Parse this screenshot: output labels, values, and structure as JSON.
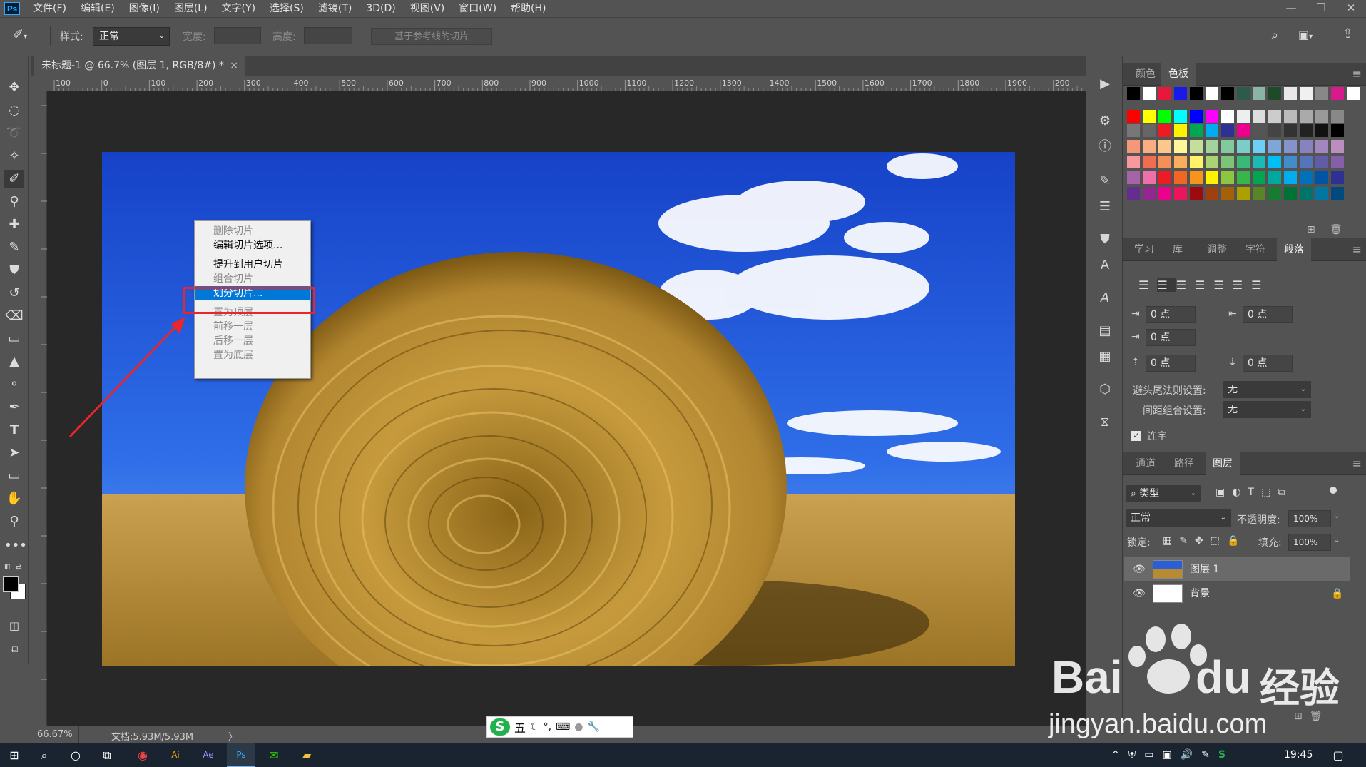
{
  "menubar": {
    "logo": "Ps",
    "items": [
      "文件(F)",
      "编辑(E)",
      "图像(I)",
      "图层(L)",
      "文字(Y)",
      "选择(S)",
      "滤镜(T)",
      "3D(D)",
      "视图(V)",
      "窗口(W)",
      "帮助(H)"
    ]
  },
  "window_controls": {
    "minimize": "—",
    "restore": "❐",
    "close": "✕"
  },
  "options": {
    "style_label": "样式:",
    "style_value": "正常",
    "width_label": "宽度:",
    "height_label": "高度:",
    "guides_button": "基于参考线的切片"
  },
  "document": {
    "tab_title": "未标题-1 @ 66.7% (图层 1, RGB/8#) *",
    "close": "×",
    "zoom": "66.67%",
    "doc_size": "文档:5.93M/5.93M",
    "arrow": "〉"
  },
  "ruler_h": [
    "100",
    "0",
    "100",
    "200",
    "300",
    "400",
    "500",
    "600",
    "700",
    "800",
    "900",
    "1000",
    "1100",
    "1200",
    "1300",
    "1400",
    "1500",
    "1600",
    "1700",
    "1800",
    "1900",
    "200"
  ],
  "context_menu": {
    "items": [
      {
        "label": "删除切片",
        "state": "disabled"
      },
      {
        "label": "编辑切片选项...",
        "state": "enabled"
      },
      {
        "label": "提升到用户切片",
        "state": "enabled"
      },
      {
        "label": "组合切片",
        "state": "disabled"
      },
      {
        "label": "划分切片...",
        "state": "highlighted"
      },
      {
        "label": "置为顶层",
        "state": "disabled"
      },
      {
        "label": "前移一层",
        "state": "disabled"
      },
      {
        "label": "后移一层",
        "state": "disabled"
      },
      {
        "label": "置为底层",
        "state": "disabled"
      }
    ]
  },
  "swatches_panel": {
    "tabs": [
      "颜色",
      "色板"
    ],
    "active": "色板",
    "colors": [
      [
        "#000000",
        "#ffffff",
        "#e8183c",
        "#1a1ae8",
        "#000000",
        "#ffffff",
        "#000000",
        "#2d5a4a",
        "#8ab4a8",
        "#1f4a2a",
        "#e8e8e8",
        "#f0f0f0",
        "#888888",
        "#d81b8c",
        "#ffffff"
      ],
      [
        "#ff0000",
        "#ffff00",
        "#00ff00",
        "#00ffff",
        "#0000ff",
        "#ff00ff",
        "#ffffff",
        "#eeeeee",
        "#dddddd",
        "#cccccc",
        "#bbbbbb",
        "#aaaaaa",
        "#999999",
        "#888888"
      ],
      [
        "#777777",
        "#666666",
        "#ed1c24",
        "#fff200",
        "#00a651",
        "#00aeef",
        "#2e3192",
        "#ec008c",
        "#555555",
        "#444444",
        "#333333",
        "#222222",
        "#111111",
        "#000000"
      ],
      [
        "#f7977a",
        "#f9ad81",
        "#fdc68a",
        "#fff79a",
        "#c4df9b",
        "#a3d39c",
        "#82ca9d",
        "#7bcdc8",
        "#6ecff6",
        "#7ea7d8",
        "#8493ca",
        "#8882be",
        "#a187be",
        "#bc8dbf"
      ],
      [
        "#f6989d",
        "#f26c4f",
        "#f68e55",
        "#fbaf5c",
        "#fff467",
        "#acd372",
        "#7cc576",
        "#3bb878",
        "#1abbb4",
        "#00bff3",
        "#438ccb",
        "#5574b9",
        "#605ca8",
        "#855fa8"
      ],
      [
        "#a763a8",
        "#f06eaa",
        "#ed1c24",
        "#f26522",
        "#f7941d",
        "#fff200",
        "#8dc73f",
        "#39b54a",
        "#00a651",
        "#00a99d",
        "#00aeef",
        "#0072bc",
        "#0054a6",
        "#2e3192"
      ],
      [
        "#662d91",
        "#92278f",
        "#ec008c",
        "#ed145b",
        "#9e0b0f",
        "#a0410d",
        "#a36209",
        "#aba000",
        "#598527",
        "#197b30",
        "#007236",
        "#00746b",
        "#0076a3",
        "#004a80"
      ]
    ]
  },
  "paragraph_panel": {
    "tabs": [
      "学习",
      "库",
      "调整",
      "字符",
      "段落"
    ],
    "active": "段落",
    "indent_left": "0 点",
    "indent_right": "0 点",
    "indent_first": "0 点",
    "space_before": "0 点",
    "space_after": "0 点",
    "kinsoku_label": "避头尾法则设置:",
    "kinsoku_value": "无",
    "mojikumi_label": "间距组合设置:",
    "mojikumi_value": "无",
    "hyphen_label": "连字"
  },
  "layers_panel": {
    "tabs": [
      "通道",
      "路径",
      "图层"
    ],
    "active": "图层",
    "filter": "类型",
    "blend_mode": "正常",
    "opacity_label": "不透明度:",
    "opacity_value": "100%",
    "lock_label": "锁定:",
    "fill_label": "填充:",
    "fill_value": "100%",
    "layers": [
      {
        "name": "图层 1",
        "selected": true
      },
      {
        "name": "背景",
        "selected": false
      }
    ]
  },
  "ime": {
    "label": "五"
  },
  "taskbar": {
    "time": "19:45"
  },
  "watermark": {
    "brand": "Bai",
    "brand2": "du",
    "cn": "经验",
    "url": "jingyan.baidu.com"
  }
}
